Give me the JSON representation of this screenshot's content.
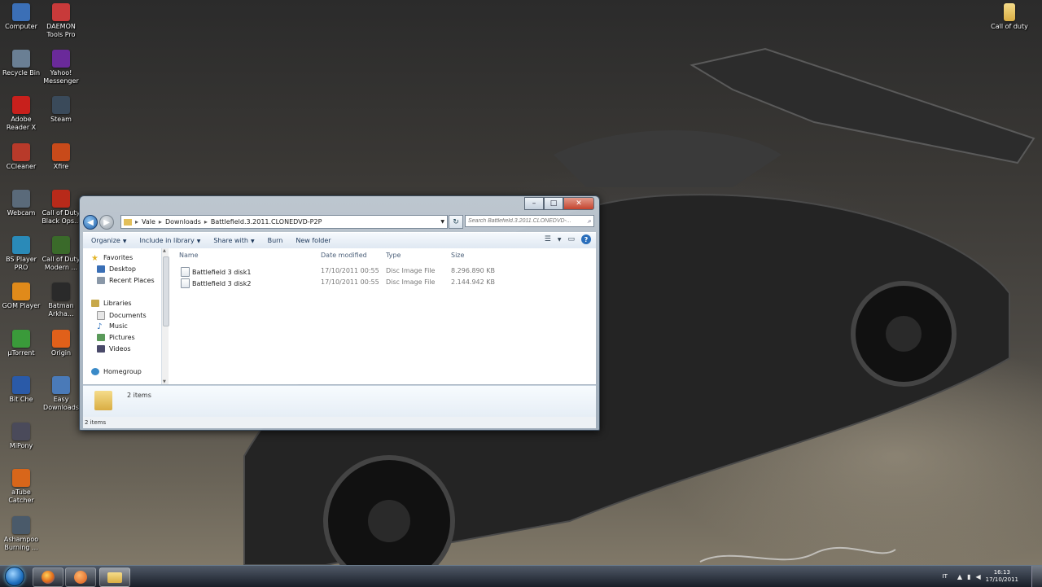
{
  "desktop": {
    "icons_left": [
      {
        "label": "Computer",
        "icon": "computer-icon",
        "color": "#3b6fb6"
      },
      {
        "label": "Recycle Bin",
        "icon": "recycle-bin-icon",
        "color": "#6a7f94"
      },
      {
        "label": "Adobe Reader X",
        "icon": "adobe-reader-icon",
        "color": "#c8201c"
      },
      {
        "label": "CCleaner",
        "icon": "ccleaner-icon",
        "color": "#b83a2a"
      },
      {
        "label": "Webcam",
        "icon": "webcam-icon",
        "color": "#5a6a7a"
      },
      {
        "label": "BS Player PRO",
        "icon": "bsplayer-icon",
        "color": "#2a8ab8"
      },
      {
        "label": "GOM Player",
        "icon": "gom-player-icon",
        "color": "#e08a1a"
      },
      {
        "label": "µTorrent",
        "icon": "utorrent-icon",
        "color": "#3a9a3a"
      },
      {
        "label": "Bit Che",
        "icon": "bitche-icon",
        "color": "#2a5aa8"
      },
      {
        "label": "MiPony",
        "icon": "mipony-icon",
        "color": "#4a4a5a"
      },
      {
        "label": "aTube Catcher",
        "icon": "atube-catcher-icon",
        "color": "#d8661a"
      },
      {
        "label": "Ashampoo Burning ...",
        "icon": "ashampoo-icon",
        "color": "#4a5a6a"
      }
    ],
    "icons_right_col": [
      {
        "label": "DAEMON Tools Pro",
        "icon": "daemon-tools-icon",
        "color": "#c83a3a"
      },
      {
        "label": "Yahoo! Messenger",
        "icon": "yahoo-messenger-icon",
        "color": "#6a2a9a"
      },
      {
        "label": "Steam",
        "icon": "steam-icon",
        "color": "#3a4a5a"
      },
      {
        "label": "Xfire",
        "icon": "xfire-icon",
        "color": "#c84a1a"
      },
      {
        "label": "Call of Duty Black Ops...",
        "icon": "cod-black-ops-icon",
        "color": "#b82a1a"
      },
      {
        "label": "Call of Duty Modern ...",
        "icon": "cod-modern-icon",
        "color": "#3a6a2a"
      },
      {
        "label": "Batman Arkha...",
        "icon": "batman-icon",
        "color": "#2a2a2a"
      },
      {
        "label": "Origin",
        "icon": "origin-icon",
        "color": "#e0601a"
      },
      {
        "label": "Easy Downloads",
        "icon": "easy-downloads-icon",
        "color": "#4a7ab8"
      }
    ],
    "icon_top_right": {
      "label": "Call of duty",
      "icon": "folder-icon",
      "color": "#e5c25a"
    }
  },
  "explorer": {
    "address": {
      "crumbs": [
        "Vale",
        "Downloads",
        "Battlefield.3.2011.CLONEDVD-P2P"
      ],
      "separator": "▸"
    },
    "search_placeholder": "Search Battlefield.3.2011.CLONEDVD-...",
    "toolbar": {
      "organize": "Organize",
      "include_in_library": "Include in library",
      "share_with": "Share with",
      "burn": "Burn",
      "new_folder": "New folder"
    },
    "nav": {
      "favorites": "Favorites",
      "desktop": "Desktop",
      "recent_places": "Recent Places",
      "libraries": "Libraries",
      "documents": "Documents",
      "music": "Music",
      "pictures": "Pictures",
      "videos": "Videos",
      "homegroup": "Homegroup"
    },
    "columns": {
      "name": "Name",
      "date": "Date modified",
      "type": "Type",
      "size": "Size"
    },
    "files": [
      {
        "name": "Battlefield 3 disk1",
        "date": "17/10/2011 00:55",
        "type": "Disc Image File",
        "size": "8.296.890 KB"
      },
      {
        "name": "Battlefield 3 disk2",
        "date": "17/10/2011 00:55",
        "type": "Disc Image File",
        "size": "2.144.942 KB"
      }
    ],
    "details_count": "2 items",
    "status": "2 items"
  },
  "taskbar": {
    "language": "IT",
    "time": "16:13",
    "date": "17/10/2011",
    "apps": [
      "firefox-icon",
      "origin-taskbar-icon",
      "explorer-icon"
    ]
  },
  "colors": {
    "accent": "#1e6fbe",
    "window_frame": "#aebfd0"
  }
}
